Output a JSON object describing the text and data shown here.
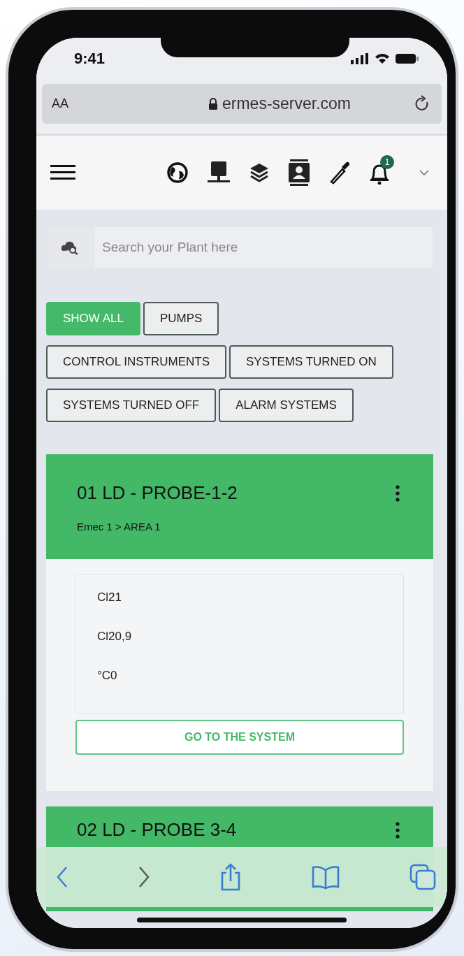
{
  "status_bar": {
    "time": "9:41"
  },
  "browser": {
    "text_size": "AA",
    "url": "ermes-server.com"
  },
  "nav": {
    "notification_count": "1"
  },
  "search": {
    "placeholder": "Search your Plant here"
  },
  "filters": [
    {
      "label": "SHOW ALL",
      "selected": true
    },
    {
      "label": "PUMPS",
      "selected": false
    },
    {
      "label": "CONTROL INSTRUMENTS",
      "selected": false
    },
    {
      "label": "SYSTEMS TURNED ON",
      "selected": false
    },
    {
      "label": "SYSTEMS TURNED OFF",
      "selected": false
    },
    {
      "label": "ALARM SYSTEMS",
      "selected": false
    }
  ],
  "cards": [
    {
      "title": "01 LD - PROBE-1-2",
      "path": "Emec 1 > AREA 1",
      "readings": [
        "Cl21",
        "Cl20,9",
        "°C0"
      ],
      "button": "GO TO THE SYSTEM"
    },
    {
      "title": "02 LD - PROBE 3-4"
    }
  ]
}
